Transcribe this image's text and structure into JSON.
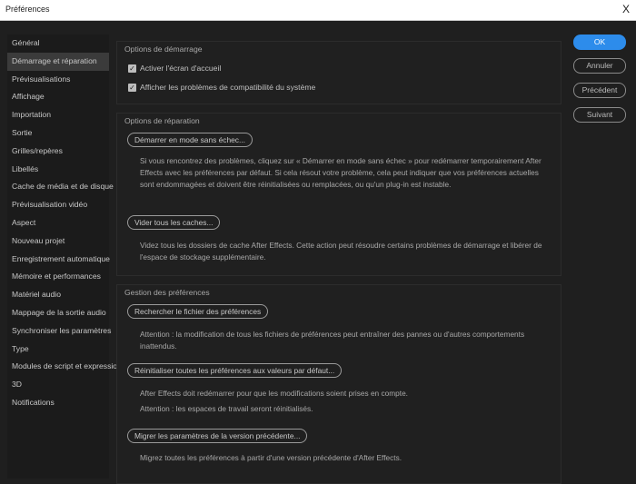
{
  "window": {
    "title": "Préférences",
    "close": "X"
  },
  "sidebar": {
    "items": [
      "Général",
      "Démarrage et réparation",
      "Prévisualisations",
      "Affichage",
      "Importation",
      "Sortie",
      "Grilles/repères",
      "Libellés",
      "Cache de média et de disque",
      "Prévisualisation vidéo",
      "Aspect",
      "Nouveau projet",
      "Enregistrement automatique",
      "Mémoire et performances",
      "Matériel audio",
      "Mappage de la sortie audio",
      "Synchroniser les paramètres",
      "Type",
      "Modules de script et expressions",
      "3D",
      "Notifications"
    ],
    "selected": 1
  },
  "startup": {
    "title": "Options de démarrage",
    "options": [
      {
        "label": "Activer l'écran d'accueil",
        "checked": true
      },
      {
        "label": "Afficher les problèmes de compatibilité du système",
        "checked": true
      }
    ]
  },
  "repair": {
    "title": "Options de réparation",
    "safe_mode_button": "Démarrer en mode sans échec...",
    "safe_mode_desc": "Si vous rencontrez des problèmes, cliquez sur « Démarrer en mode sans échec » pour redémarrer temporairement After Effects avec les préférences par défaut. Si cela résout votre problème, cela peut indiquer que vos préférences actuelles sont endommagées et doivent être réinitialisées ou remplacées, ou qu'un plug-in est instable.",
    "clear_cache_button": "Vider tous les caches...",
    "clear_cache_desc": "Videz tous les dossiers de cache After Effects. Cette action peut résoudre certains problèmes de démarrage et libérer de l'espace de stockage supplémentaire."
  },
  "prefs": {
    "title": "Gestion des préférences",
    "find_button": "Rechercher le fichier des préférences",
    "find_desc": "Attention : la modification de tous les fichiers de préférences peut entraîner des pannes ou d'autres comportements inattendus.",
    "reset_button": "Réinitialiser toutes les préférences aux valeurs par défaut...",
    "reset_desc1": "After Effects doit redémarrer pour que les modifications soient prises en compte.",
    "reset_desc2": "Attention : les espaces de travail seront réinitialisés.",
    "migrate_button": "Migrer les paramètres de la version précédente...",
    "migrate_desc": "Migrez toutes les préférences à partir d'une version précédente d'After Effects."
  },
  "actions": {
    "ok": "OK",
    "cancel": "Annuler",
    "previous": "Précédent",
    "next": "Suivant"
  },
  "colors": {
    "accent": "#2d8ceb"
  }
}
